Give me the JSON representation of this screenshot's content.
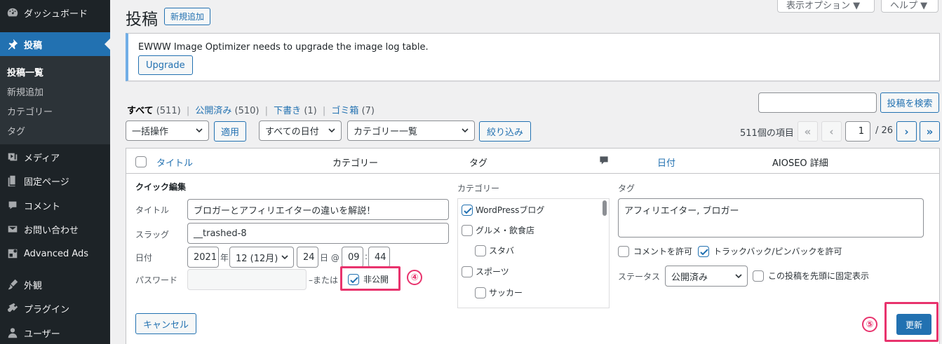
{
  "sidebar": {
    "items": [
      {
        "label": "ダッシュボード",
        "icon": "dashboard-icon"
      },
      {
        "label": "投稿",
        "icon": "pin-icon",
        "active": true
      },
      {
        "label": "メディア",
        "icon": "media-icon"
      },
      {
        "label": "固定ページ",
        "icon": "page-icon"
      },
      {
        "label": "コメント",
        "icon": "comment-icon"
      },
      {
        "label": "お問い合わせ",
        "icon": "mail-icon"
      },
      {
        "label": "Advanced Ads",
        "icon": "ads-icon"
      },
      {
        "label": "外観",
        "icon": "brush-icon"
      },
      {
        "label": "プラグイン",
        "icon": "plugin-icon"
      },
      {
        "label": "ユーザー",
        "icon": "user-icon"
      }
    ],
    "submenu": [
      "投稿一覧",
      "新規追加",
      "カテゴリー",
      "タグ"
    ]
  },
  "header": {
    "title": "投稿",
    "add_new": "新規追加",
    "screen_options": "表示オプション ▼",
    "help": "ヘルプ ▼"
  },
  "notice": {
    "text": "EWWW Image Optimizer needs to upgrade the image log table.",
    "button": "Upgrade"
  },
  "views": {
    "all": "すべて",
    "all_count": "(511)",
    "publish": "公開済み",
    "publish_count": "(510)",
    "draft": "下書き",
    "draft_count": "(1)",
    "trash": "ゴミ箱",
    "trash_count": "(7)",
    "sep": "|"
  },
  "search": {
    "button": "投稿を検索",
    "value": ""
  },
  "filters": {
    "bulk": "一括操作",
    "apply": "適用",
    "dates": "すべての日付",
    "category": "カテゴリー一覧",
    "filter": "絞り込み"
  },
  "pagination": {
    "items": "511個の項目",
    "first": "«",
    "prev": "‹",
    "next": "›",
    "last": "»",
    "current": "1",
    "total": "/ 26"
  },
  "table": {
    "columns": {
      "title": "タイトル",
      "category": "カテゴリー",
      "tags": "タグ",
      "date": "日付",
      "aioseo": "AIOSEO 詳細"
    }
  },
  "quick_edit": {
    "heading": "クイック編集",
    "title_label": "タイトル",
    "title_value": "ブロガーとアフィリエイターの違いを解説！",
    "slug_label": "スラッグ",
    "slug_value": "__trashed-8",
    "date_label": "日付",
    "year": "2021",
    "year_unit": "年",
    "month": "12 (12月)",
    "day": "24",
    "day_unit": "日 @",
    "hour": "09",
    "colon": ":",
    "minute": "44",
    "password_label": "パスワード",
    "password_value": "",
    "or": "–または",
    "private": "非公開",
    "private_checked": true,
    "categories_heading": "カテゴリー",
    "categories": [
      {
        "label": "WordPressブログ",
        "checked": true,
        "indent": 0
      },
      {
        "label": "グルメ・飲食店",
        "checked": false,
        "indent": 0
      },
      {
        "label": "スタバ",
        "checked": false,
        "indent": 1
      },
      {
        "label": "スポーツ",
        "checked": false,
        "indent": 0
      },
      {
        "label": "サッカー",
        "checked": false,
        "indent": 1
      }
    ],
    "tags_heading": "タグ",
    "tags_value": "アフィリエイター, ブロガー",
    "allow_comments": "コメントを許可",
    "allow_comments_checked": false,
    "allow_pings": "トラックバック/ピンバックを許可",
    "allow_pings_checked": true,
    "status_label": "ステータス",
    "status_value": "公開済み",
    "sticky": "この投稿を先頭に固定表示",
    "sticky_checked": false,
    "cancel": "キャンセル",
    "update": "更新"
  },
  "annotations": {
    "step4": "④",
    "step5": "⑤",
    "color": "#e8336d"
  }
}
